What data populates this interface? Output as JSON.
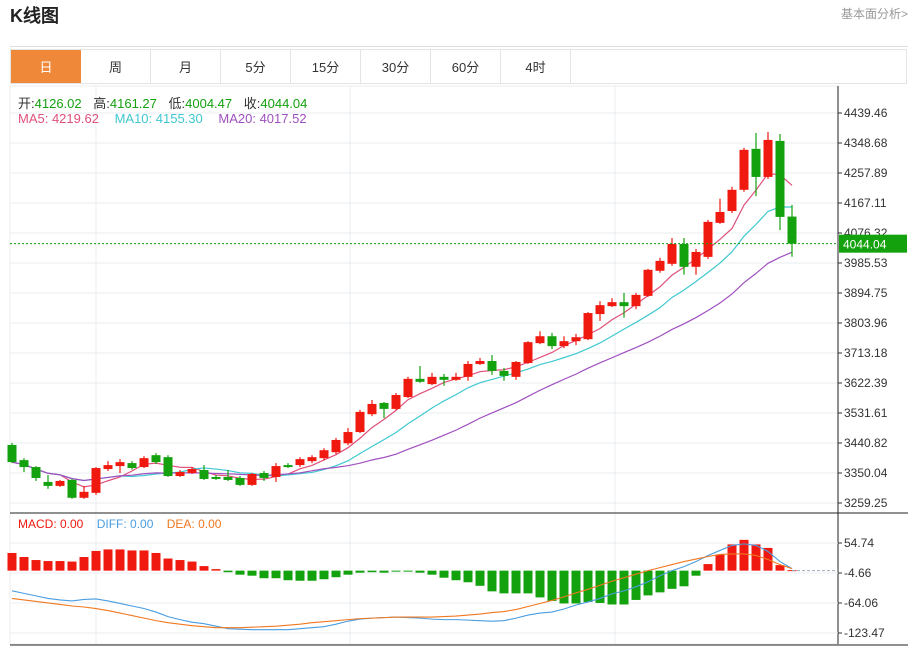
{
  "header": {
    "title": "K线图",
    "link": "基本面分析>"
  },
  "tabs": [
    {
      "label": "日",
      "active": true
    },
    {
      "label": "周"
    },
    {
      "label": "月"
    },
    {
      "label": "5分"
    },
    {
      "label": "15分"
    },
    {
      "label": "30分"
    },
    {
      "label": "60分"
    },
    {
      "label": "4时"
    }
  ],
  "ohlc": {
    "open_label": "开:",
    "open": "4126.02",
    "high_label": "高:",
    "high": "4161.27",
    "low_label": "低:",
    "low": "4004.47",
    "close_label": "收:",
    "close": "4044.04"
  },
  "ma": {
    "ma5": "MA5: 4219.62",
    "ma10": "MA10: 4155.30",
    "ma20": "MA20: 4017.52"
  },
  "macd_legend": {
    "macd": "MACD: 0.00",
    "diff": "DIFF: 0.00",
    "dea": "DEA: 0.00"
  },
  "colors": {
    "up": "#f0190f",
    "down": "#13a10e",
    "ma5": "#e0507a",
    "ma10": "#3fc8d0",
    "ma20": "#a050c0",
    "diff": "#4a9de0",
    "dea": "#f07820",
    "accent": "#f0883a"
  },
  "chart_data": {
    "type": "candlestick",
    "price_ticks": [
      "4439.46",
      "4348.68",
      "4257.89",
      "4167.11",
      "4076.32",
      "3985.53",
      "3894.75",
      "3803.96",
      "3713.18",
      "3622.39",
      "3531.61",
      "3440.82",
      "3350.04",
      "3259.25"
    ],
    "price_range": [
      3259.25,
      4439.46
    ],
    "last_price": "4044.04",
    "candles": [
      [
        3435,
        3441,
        3380,
        3383
      ],
      [
        3389,
        3395,
        3353,
        3368
      ],
      [
        3368,
        3371,
        3326,
        3335
      ],
      [
        3323,
        3344,
        3302,
        3311
      ],
      [
        3311,
        3329,
        3308,
        3326
      ],
      [
        3329,
        3332,
        3272,
        3275
      ],
      [
        3275,
        3311,
        3272,
        3293
      ],
      [
        3290,
        3368,
        3284,
        3365
      ],
      [
        3362,
        3386,
        3356,
        3374
      ],
      [
        3371,
        3392,
        3350,
        3383
      ],
      [
        3380,
        3386,
        3360,
        3365
      ],
      [
        3368,
        3401,
        3365,
        3395
      ],
      [
        3404,
        3410,
        3377,
        3383
      ],
      [
        3398,
        3404,
        3338,
        3341
      ],
      [
        3341,
        3359,
        3338,
        3353
      ],
      [
        3350,
        3368,
        3347,
        3362
      ],
      [
        3359,
        3374,
        3329,
        3332
      ],
      [
        3338,
        3344,
        3329,
        3332
      ],
      [
        3338,
        3359,
        3326,
        3329
      ],
      [
        3335,
        3341,
        3311,
        3314
      ],
      [
        3314,
        3350,
        3311,
        3347
      ],
      [
        3350,
        3356,
        3326,
        3335
      ],
      [
        3338,
        3380,
        3323,
        3371
      ],
      [
        3374,
        3380,
        3365,
        3368
      ],
      [
        3374,
        3398,
        3368,
        3392
      ],
      [
        3386,
        3404,
        3380,
        3398
      ],
      [
        3395,
        3425,
        3389,
        3419
      ],
      [
        3413,
        3456,
        3407,
        3450
      ],
      [
        3440,
        3486,
        3434,
        3474
      ],
      [
        3474,
        3541,
        3471,
        3535
      ],
      [
        3528,
        3571,
        3522,
        3559
      ],
      [
        3562,
        3565,
        3516,
        3544
      ],
      [
        3544,
        3592,
        3541,
        3586
      ],
      [
        3580,
        3641,
        3577,
        3635
      ],
      [
        3635,
        3674,
        3623,
        3626
      ],
      [
        3619,
        3653,
        3616,
        3641
      ],
      [
        3641,
        3650,
        3614,
        3632
      ],
      [
        3632,
        3653,
        3629,
        3641
      ],
      [
        3641,
        3689,
        3629,
        3680
      ],
      [
        3680,
        3698,
        3677,
        3689
      ],
      [
        3689,
        3707,
        3647,
        3659
      ],
      [
        3659,
        3668,
        3629,
        3644
      ],
      [
        3641,
        3689,
        3632,
        3686
      ],
      [
        3683,
        3749,
        3680,
        3746
      ],
      [
        3743,
        3779,
        3740,
        3764
      ],
      [
        3764,
        3774,
        3725,
        3734
      ],
      [
        3734,
        3764,
        3728,
        3749
      ],
      [
        3749,
        3771,
        3737,
        3761
      ],
      [
        3755,
        3837,
        3752,
        3834
      ],
      [
        3831,
        3870,
        3810,
        3858
      ],
      [
        3855,
        3879,
        3852,
        3867
      ],
      [
        3867,
        3895,
        3820,
        3855
      ],
      [
        3855,
        3895,
        3846,
        3889
      ],
      [
        3886,
        3968,
        3883,
        3965
      ],
      [
        3962,
        4001,
        3956,
        3992
      ],
      [
        3983,
        4061,
        3977,
        4043
      ],
      [
        4043,
        4061,
        3950,
        3974
      ],
      [
        3974,
        4028,
        3950,
        4019
      ],
      [
        4004,
        4116,
        3998,
        4110
      ],
      [
        4107,
        4180,
        4104,
        4140
      ],
      [
        4143,
        4216,
        4137,
        4207
      ],
      [
        4207,
        4334,
        4201,
        4328
      ],
      [
        4331,
        4379,
        4188,
        4246
      ],
      [
        4246,
        4382,
        4240,
        4358
      ],
      [
        4355,
        4376,
        4085,
        4125
      ],
      [
        4126.02,
        4161.27,
        4004.47,
        4044.04
      ]
    ],
    "macd_ticks": [
      "54.74",
      "-4.66",
      "-64.06",
      "-123.47"
    ],
    "macd_hist": [
      35,
      27,
      21,
      19,
      19,
      18,
      27,
      39,
      42,
      42,
      40,
      40,
      35,
      24,
      21,
      18,
      9,
      3,
      -3,
      -8,
      -10,
      -15,
      -15,
      -19,
      -20,
      -20,
      -17,
      -13,
      -8,
      -4,
      -3,
      -4,
      -1,
      -1,
      -4,
      -8,
      -14,
      -19,
      -23,
      -30,
      -41,
      -45,
      -45,
      -45,
      -53,
      -60,
      -65,
      -65,
      -62,
      -64,
      -67,
      -67,
      -58,
      -49,
      -43,
      -36,
      -31,
      -10,
      13,
      32,
      52,
      61,
      52,
      45,
      11,
      1
    ],
    "diff": [
      -40,
      -45,
      -50,
      -55,
      -58,
      -60,
      -57,
      -56,
      -60,
      -65,
      -70,
      -75,
      -82,
      -91,
      -97,
      -102,
      -105,
      -110,
      -115,
      -116,
      -117,
      -117,
      -117,
      -117,
      -115,
      -113,
      -111,
      -106,
      -100,
      -96,
      -94,
      -93,
      -92,
      -93,
      -94,
      -96,
      -97,
      -97,
      -98,
      -99,
      -100,
      -99,
      -94,
      -88,
      -84,
      -82,
      -76,
      -68,
      -62,
      -55,
      -46,
      -40,
      -32,
      -22,
      -10,
      0,
      8,
      18,
      30,
      40,
      50,
      53,
      50,
      38,
      18,
      4
    ],
    "dea": [
      -55,
      -58,
      -61,
      -64,
      -67,
      -70,
      -72,
      -75,
      -79,
      -84,
      -89,
      -94,
      -99,
      -103,
      -106,
      -109,
      -111,
      -113,
      -113,
      -113,
      -112,
      -111,
      -110,
      -108,
      -106,
      -103,
      -101,
      -99,
      -97,
      -95,
      -94,
      -93,
      -92,
      -92,
      -92,
      -92,
      -91,
      -90,
      -88,
      -86,
      -83,
      -81,
      -77,
      -71,
      -65,
      -59,
      -52,
      -44,
      -37,
      -29,
      -21,
      -14,
      -7,
      0,
      6,
      12,
      18,
      23,
      28,
      32,
      33,
      33,
      30,
      22,
      12,
      4
    ]
  }
}
